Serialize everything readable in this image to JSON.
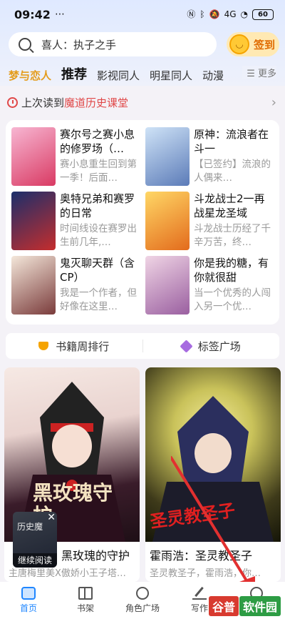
{
  "status_bar": {
    "time": "09:42",
    "dots": "⋯",
    "signal": "4G",
    "battery": "60"
  },
  "search": {
    "placeholder": "喜人：执子之手",
    "signin_label": "签到"
  },
  "tabs": [
    {
      "label": "梦与恋人",
      "style": "gold"
    },
    {
      "label": "推荐",
      "style": "active"
    },
    {
      "label": "影视同人",
      "style": ""
    },
    {
      "label": "明星同人",
      "style": ""
    },
    {
      "label": "动漫",
      "style": ""
    }
  ],
  "more_label": "☰ 更多",
  "last_read": {
    "prefix": "上次读到",
    "title": "魔道历史课堂",
    "chevron": "›"
  },
  "books": [
    {
      "title": "赛尔号之赛小息的修罗场（…",
      "desc": "赛小息重生回到第一季！后面…",
      "cover_colors": [
        "#f7b6d2",
        "#d93a63"
      ]
    },
    {
      "title": "原神：流浪者在斗一",
      "desc": "【已签约】流浪的人偶来…",
      "cover_colors": [
        "#cfe3f7",
        "#5b7bb8"
      ]
    },
    {
      "title": "奥特兄弟和赛罗的日常",
      "desc": "时间线设在赛罗出生前几年,…",
      "cover_colors": [
        "#1b2f6b",
        "#c52d2d"
      ]
    },
    {
      "title": "斗龙战士2一再战星龙圣域",
      "desc": "斗龙战士历经了千辛万苦，终…",
      "cover_colors": [
        "#ffd766",
        "#e36b1c"
      ]
    },
    {
      "title": "鬼灭聊天群（含CP）",
      "desc": "我是一个作者，但好像在这里…",
      "cover_colors": [
        "#f4e7da",
        "#7a3b3b"
      ]
    },
    {
      "title": "你是我的糖，有你就很甜",
      "desc": "当一个优秀的人闯入另一个优…",
      "cover_colors": [
        "#f0d5e5",
        "#9a5fa0"
      ]
    }
  ],
  "strip": {
    "rank_label": "书籍周排行",
    "tag_label": "标签广场"
  },
  "cards": [
    {
      "title": "黑玫瑰的守护",
      "desc": "主唐梅里美X傲娇小王子塔…",
      "art_text": "黑玫瑰守护"
    },
    {
      "title": "霍雨浩：圣灵教圣子",
      "desc": "圣灵教圣子，霍雨浩，你…",
      "art_text": "圣灵教圣子"
    }
  ],
  "float_read": {
    "label": "继续阅读",
    "close": "✕",
    "cover_text": "历史魔"
  },
  "nav": [
    {
      "label": "首页",
      "icon": "home-icon",
      "active": true
    },
    {
      "label": "书架",
      "icon": "shelf-icon",
      "active": false
    },
    {
      "label": "角色广场",
      "icon": "planet-icon",
      "active": false
    },
    {
      "label": "写作",
      "icon": "write-icon",
      "active": false
    },
    {
      "label": "我的",
      "icon": "me-icon",
      "active": false
    }
  ],
  "watermark": {
    "part1": "谷普",
    "part2": "软件园"
  },
  "colors": {
    "accent": "#1f86ff",
    "highlight": "#e04848",
    "gold": "#e49c1c"
  }
}
